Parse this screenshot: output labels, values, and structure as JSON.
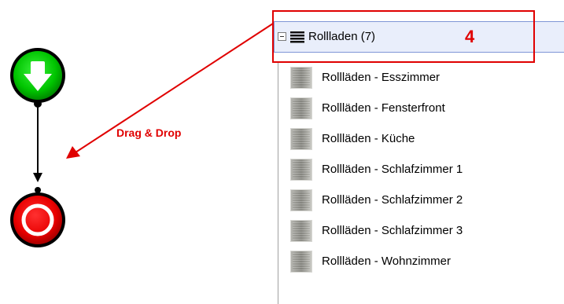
{
  "canvas": {
    "annotation_label": "Drag & Drop",
    "annotation_color": "#e00000",
    "start_node_color": "#00c000",
    "end_node_color": "#e00000"
  },
  "tree": {
    "group": {
      "label": "Rollladen (7)",
      "badge": "4",
      "expander_state": "expanded"
    },
    "items": [
      {
        "label": "Rollläden - Esszimmer"
      },
      {
        "label": "Rollläden - Fensterfront"
      },
      {
        "label": "Rollläden - Küche"
      },
      {
        "label": "Rollläden - Schlafzimmer 1"
      },
      {
        "label": "Rollläden - Schlafzimmer 2"
      },
      {
        "label": "Rollläden - Schlafzimmer 3"
      },
      {
        "label": "Rollläden - Wohnzimmer"
      }
    ],
    "icons": {
      "group": "stacked-lines-icon",
      "item": "roller-shutter-icon",
      "expander": "collapse-minus-icon"
    }
  }
}
